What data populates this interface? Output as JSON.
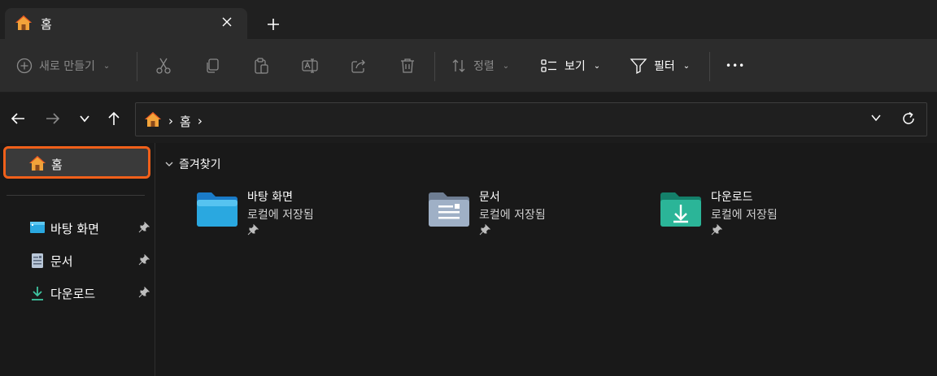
{
  "tab": {
    "title": "홈"
  },
  "toolbar": {
    "new_label": "새로 만들기",
    "sort_label": "정렬",
    "view_label": "보기",
    "filter_label": "필터",
    "more_label": "•••"
  },
  "address": {
    "crumbs": [
      "홈"
    ]
  },
  "sidebar": {
    "home_label": "홈",
    "items": [
      {
        "label": "바탕 화면",
        "icon": "desktop-icon"
      },
      {
        "label": "문서",
        "icon": "documents-icon"
      },
      {
        "label": "다운로드",
        "icon": "downloads-icon"
      }
    ]
  },
  "main": {
    "section_title": "즐겨찾기",
    "tiles": [
      {
        "name": "바탕 화면",
        "location": "로컬에 저장됨",
        "icon": "desktop-folder-icon"
      },
      {
        "name": "문서",
        "location": "로컬에 저장됨",
        "icon": "documents-folder-icon"
      },
      {
        "name": "다운로드",
        "location": "로컬에 저장됨",
        "icon": "downloads-folder-icon"
      }
    ]
  },
  "colors": {
    "accent_orange": "#f0601a",
    "background": "#191919",
    "commandbar": "#2c2c2c"
  }
}
